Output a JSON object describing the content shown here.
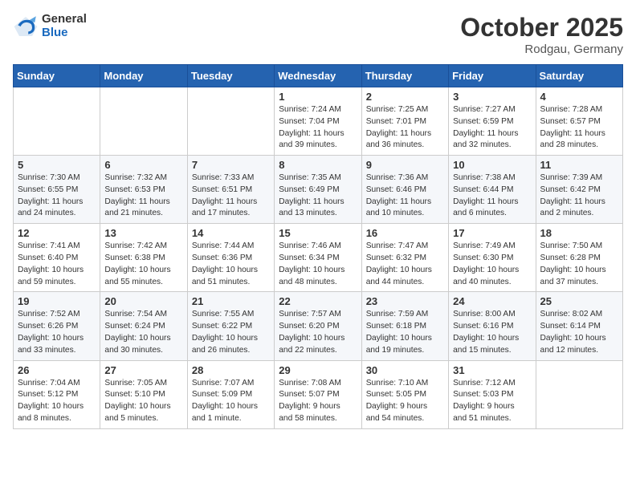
{
  "header": {
    "logo_general": "General",
    "logo_blue": "Blue",
    "month_title": "October 2025",
    "location": "Rodgau, Germany"
  },
  "weekdays": [
    "Sunday",
    "Monday",
    "Tuesday",
    "Wednesday",
    "Thursday",
    "Friday",
    "Saturday"
  ],
  "weeks": [
    [
      {
        "day": "",
        "content": ""
      },
      {
        "day": "",
        "content": ""
      },
      {
        "day": "",
        "content": ""
      },
      {
        "day": "1",
        "content": "Sunrise: 7:24 AM\nSunset: 7:04 PM\nDaylight: 11 hours\nand 39 minutes."
      },
      {
        "day": "2",
        "content": "Sunrise: 7:25 AM\nSunset: 7:01 PM\nDaylight: 11 hours\nand 36 minutes."
      },
      {
        "day": "3",
        "content": "Sunrise: 7:27 AM\nSunset: 6:59 PM\nDaylight: 11 hours\nand 32 minutes."
      },
      {
        "day": "4",
        "content": "Sunrise: 7:28 AM\nSunset: 6:57 PM\nDaylight: 11 hours\nand 28 minutes."
      }
    ],
    [
      {
        "day": "5",
        "content": "Sunrise: 7:30 AM\nSunset: 6:55 PM\nDaylight: 11 hours\nand 24 minutes."
      },
      {
        "day": "6",
        "content": "Sunrise: 7:32 AM\nSunset: 6:53 PM\nDaylight: 11 hours\nand 21 minutes."
      },
      {
        "day": "7",
        "content": "Sunrise: 7:33 AM\nSunset: 6:51 PM\nDaylight: 11 hours\nand 17 minutes."
      },
      {
        "day": "8",
        "content": "Sunrise: 7:35 AM\nSunset: 6:49 PM\nDaylight: 11 hours\nand 13 minutes."
      },
      {
        "day": "9",
        "content": "Sunrise: 7:36 AM\nSunset: 6:46 PM\nDaylight: 11 hours\nand 10 minutes."
      },
      {
        "day": "10",
        "content": "Sunrise: 7:38 AM\nSunset: 6:44 PM\nDaylight: 11 hours\nand 6 minutes."
      },
      {
        "day": "11",
        "content": "Sunrise: 7:39 AM\nSunset: 6:42 PM\nDaylight: 11 hours\nand 2 minutes."
      }
    ],
    [
      {
        "day": "12",
        "content": "Sunrise: 7:41 AM\nSunset: 6:40 PM\nDaylight: 10 hours\nand 59 minutes."
      },
      {
        "day": "13",
        "content": "Sunrise: 7:42 AM\nSunset: 6:38 PM\nDaylight: 10 hours\nand 55 minutes."
      },
      {
        "day": "14",
        "content": "Sunrise: 7:44 AM\nSunset: 6:36 PM\nDaylight: 10 hours\nand 51 minutes."
      },
      {
        "day": "15",
        "content": "Sunrise: 7:46 AM\nSunset: 6:34 PM\nDaylight: 10 hours\nand 48 minutes."
      },
      {
        "day": "16",
        "content": "Sunrise: 7:47 AM\nSunset: 6:32 PM\nDaylight: 10 hours\nand 44 minutes."
      },
      {
        "day": "17",
        "content": "Sunrise: 7:49 AM\nSunset: 6:30 PM\nDaylight: 10 hours\nand 40 minutes."
      },
      {
        "day": "18",
        "content": "Sunrise: 7:50 AM\nSunset: 6:28 PM\nDaylight: 10 hours\nand 37 minutes."
      }
    ],
    [
      {
        "day": "19",
        "content": "Sunrise: 7:52 AM\nSunset: 6:26 PM\nDaylight: 10 hours\nand 33 minutes."
      },
      {
        "day": "20",
        "content": "Sunrise: 7:54 AM\nSunset: 6:24 PM\nDaylight: 10 hours\nand 30 minutes."
      },
      {
        "day": "21",
        "content": "Sunrise: 7:55 AM\nSunset: 6:22 PM\nDaylight: 10 hours\nand 26 minutes."
      },
      {
        "day": "22",
        "content": "Sunrise: 7:57 AM\nSunset: 6:20 PM\nDaylight: 10 hours\nand 22 minutes."
      },
      {
        "day": "23",
        "content": "Sunrise: 7:59 AM\nSunset: 6:18 PM\nDaylight: 10 hours\nand 19 minutes."
      },
      {
        "day": "24",
        "content": "Sunrise: 8:00 AM\nSunset: 6:16 PM\nDaylight: 10 hours\nand 15 minutes."
      },
      {
        "day": "25",
        "content": "Sunrise: 8:02 AM\nSunset: 6:14 PM\nDaylight: 10 hours\nand 12 minutes."
      }
    ],
    [
      {
        "day": "26",
        "content": "Sunrise: 7:04 AM\nSunset: 5:12 PM\nDaylight: 10 hours\nand 8 minutes."
      },
      {
        "day": "27",
        "content": "Sunrise: 7:05 AM\nSunset: 5:10 PM\nDaylight: 10 hours\nand 5 minutes."
      },
      {
        "day": "28",
        "content": "Sunrise: 7:07 AM\nSunset: 5:09 PM\nDaylight: 10 hours\nand 1 minute."
      },
      {
        "day": "29",
        "content": "Sunrise: 7:08 AM\nSunset: 5:07 PM\nDaylight: 9 hours\nand 58 minutes."
      },
      {
        "day": "30",
        "content": "Sunrise: 7:10 AM\nSunset: 5:05 PM\nDaylight: 9 hours\nand 54 minutes."
      },
      {
        "day": "31",
        "content": "Sunrise: 7:12 AM\nSunset: 5:03 PM\nDaylight: 9 hours\nand 51 minutes."
      },
      {
        "day": "",
        "content": ""
      }
    ]
  ]
}
